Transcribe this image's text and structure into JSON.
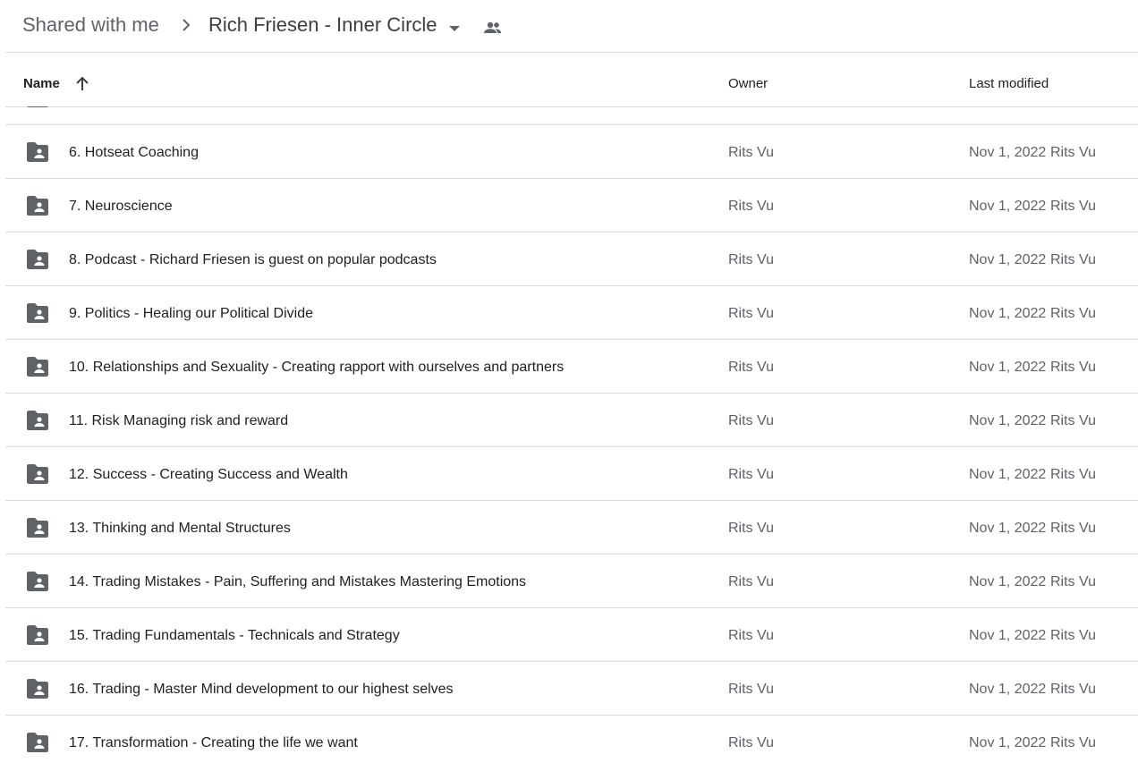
{
  "breadcrumb": {
    "root": "Shared with me",
    "current": "Rich Friesen - Inner Circle"
  },
  "columns": {
    "name": "Name",
    "owner": "Owner",
    "last_modified": "Last modified"
  },
  "icons": {
    "separator": "chevron-right-icon",
    "dropdown": "arrow-drop-down-icon",
    "shared": "people-icon",
    "sort": "arrow-up-icon",
    "folder": "shared-folder-icon"
  },
  "colors": {
    "icon": "#5f6368",
    "divider": "#dadce0",
    "text": "#202124",
    "secondary_text": "#5f6368"
  },
  "rows": [
    {
      "name": "6. Hotseat Coaching",
      "owner": "Rits Vu",
      "date": "Nov 1, 2022",
      "modifier": "Rits Vu"
    },
    {
      "name": "7. Neuroscience",
      "owner": "Rits Vu",
      "date": "Nov 1, 2022",
      "modifier": "Rits Vu"
    },
    {
      "name": "8. Podcast - Richard Friesen is guest on popular podcasts",
      "owner": "Rits Vu",
      "date": "Nov 1, 2022",
      "modifier": "Rits Vu"
    },
    {
      "name": "9. Politics - Healing our Political Divide",
      "owner": "Rits Vu",
      "date": "Nov 1, 2022",
      "modifier": "Rits Vu"
    },
    {
      "name": "10. Relationships and Sexuality - Creating rapport with ourselves and partners",
      "owner": "Rits Vu",
      "date": "Nov 1, 2022",
      "modifier": "Rits Vu"
    },
    {
      "name": "11. Risk Managing risk and reward",
      "owner": "Rits Vu",
      "date": "Nov 1, 2022",
      "modifier": "Rits Vu"
    },
    {
      "name": "12. Success - Creating Success and Wealth",
      "owner": "Rits Vu",
      "date": "Nov 1, 2022",
      "modifier": "Rits Vu"
    },
    {
      "name": "13. Thinking and Mental Structures",
      "owner": "Rits Vu",
      "date": "Nov 1, 2022",
      "modifier": "Rits Vu"
    },
    {
      "name": "14. Trading Mistakes - Pain, Suffering and Mistakes Mastering Emotions",
      "owner": "Rits Vu",
      "date": "Nov 1, 2022",
      "modifier": "Rits Vu"
    },
    {
      "name": "15. Trading Fundamentals - Technicals and Strategy",
      "owner": "Rits Vu",
      "date": "Nov 1, 2022",
      "modifier": "Rits Vu"
    },
    {
      "name": "16. Trading - Master Mind development to our highest selves",
      "owner": "Rits Vu",
      "date": "Nov 1, 2022",
      "modifier": "Rits Vu"
    },
    {
      "name": "17. Transformation - Creating the life we want",
      "owner": "Rits Vu",
      "date": "Nov 1, 2022",
      "modifier": "Rits Vu"
    }
  ]
}
